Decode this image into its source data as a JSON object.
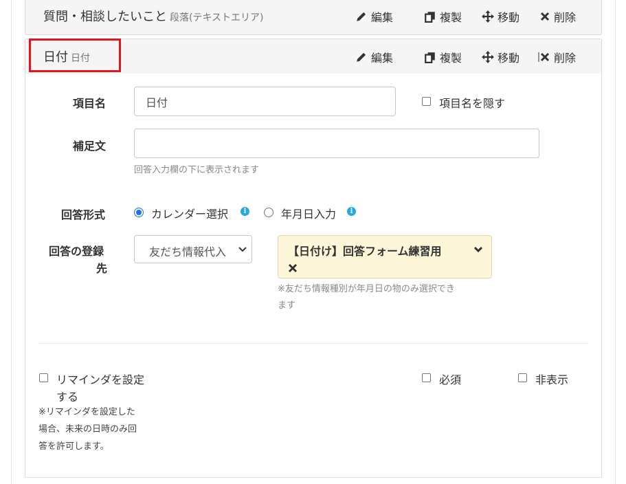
{
  "panel_prev": {
    "title": "質問・相談したいこと",
    "type_label": "段落(テキストエリア)",
    "actions": {
      "edit": "編集",
      "copy": "複製",
      "move": "移動",
      "delete": "削除"
    }
  },
  "panel_current": {
    "title": "日付",
    "type_label": "日付",
    "actions": {
      "edit": "編集",
      "copy": "複製",
      "move": "移動",
      "delete": "削除"
    }
  },
  "form": {
    "item_name": {
      "label": "項目名",
      "value": "日付",
      "hide_label": "項目名を隠す"
    },
    "supplement": {
      "label": "補足文",
      "value": "",
      "help": "回答入力欄の下に表示されます"
    },
    "answer_format": {
      "label": "回答形式",
      "options": [
        {
          "label": "カレンダー選択",
          "selected": true
        },
        {
          "label": "年月日入力",
          "selected": false
        }
      ]
    },
    "register_to": {
      "label_line1": "回答の登録",
      "label_line2": "先",
      "select_value": "友だち情報代入",
      "tag_label": "【日付け】回答フォーム練習用",
      "note_line1": "※友だち情報種別が年月日の物のみ選択でき",
      "note_line2": "ます"
    }
  },
  "options": {
    "reminder_line1": "リマインダを設定",
    "reminder_line2": "する",
    "reminder_note_line1": "※リマインダを設定した",
    "reminder_note_line2": "場合、未来の日時のみ回",
    "reminder_note_line3": "答を許可します。",
    "required": "必須",
    "hidden": "非表示"
  },
  "colors": {
    "highlight_border": "#e3141b",
    "radio_accent": "#1a73e8",
    "info_icon": "#26a9e0",
    "tag_bg": "#fdf6d8"
  }
}
